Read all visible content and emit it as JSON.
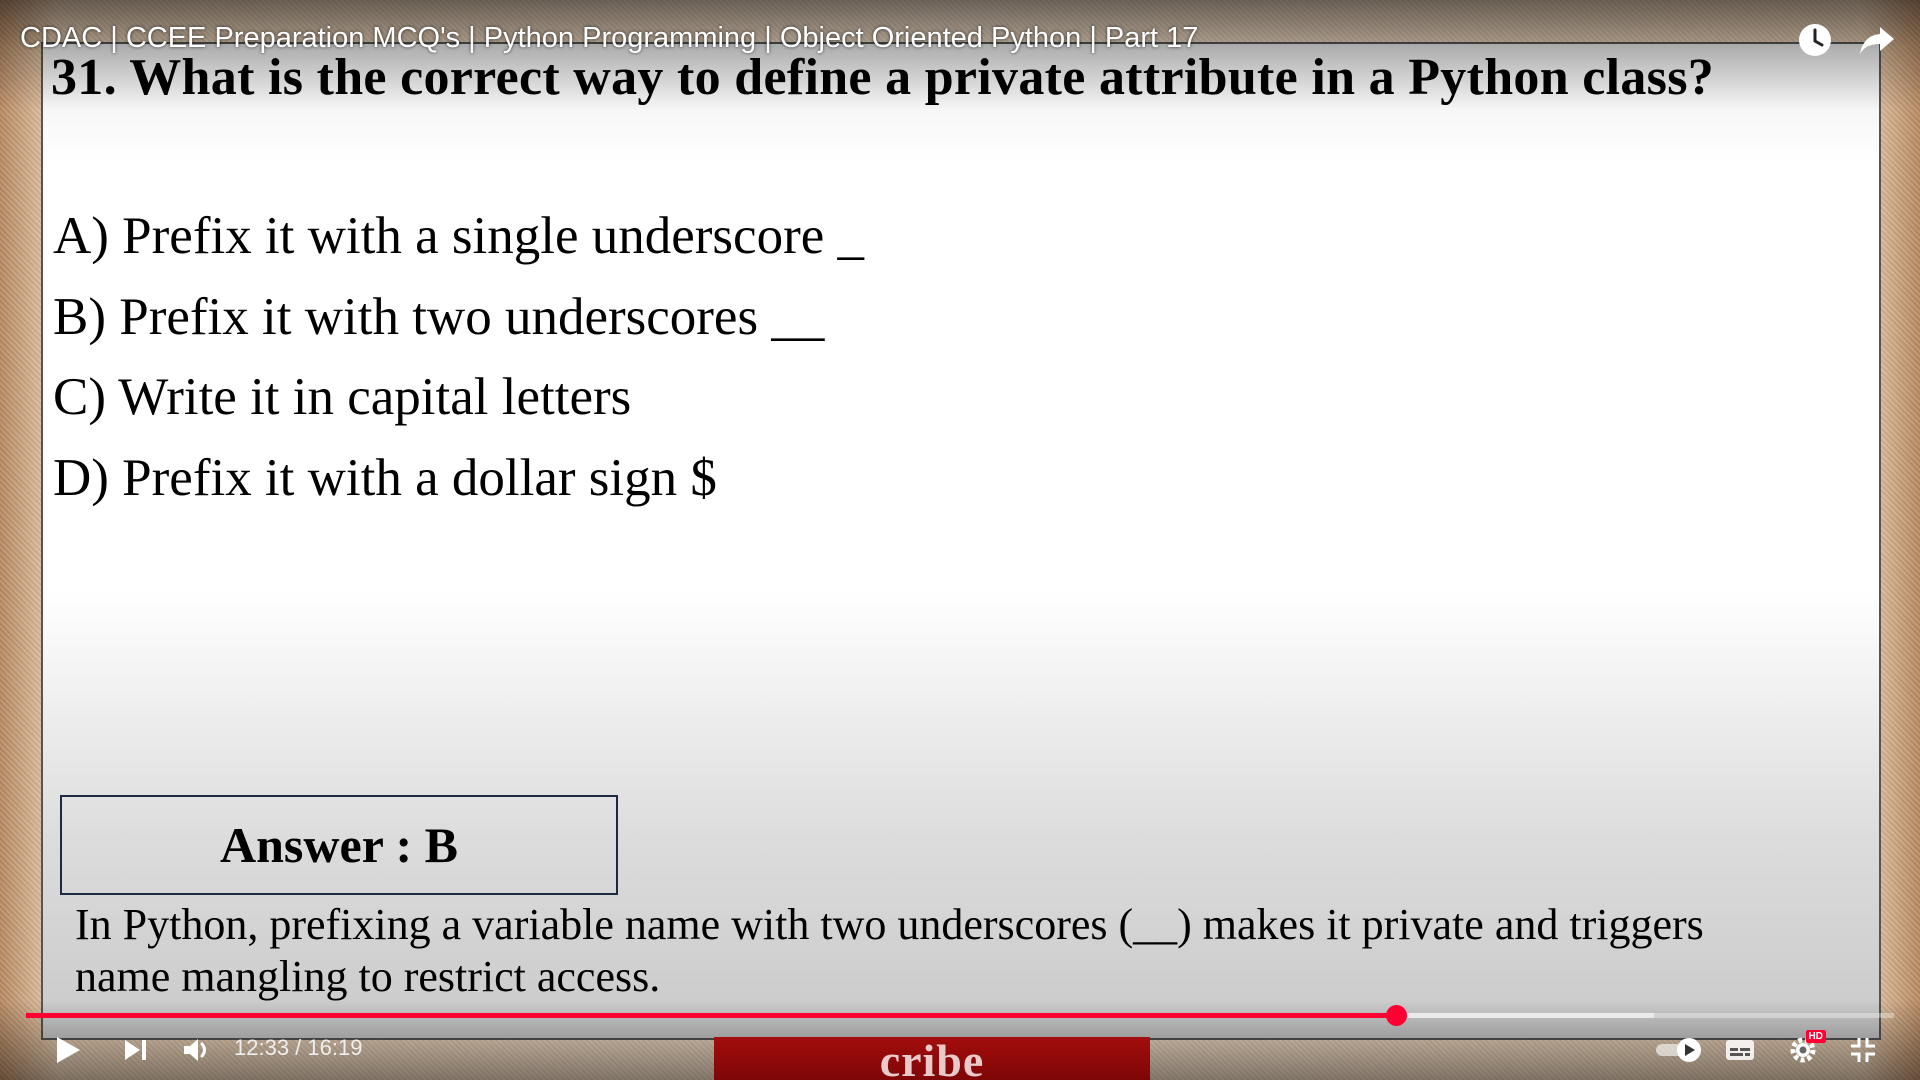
{
  "video": {
    "title": "CDAC | CCEE Preparation MCQ's | Python Programming | Object Oriented Python | Part 17",
    "time": "12:33 / 16:19",
    "progress_fraction": 0.7335,
    "buffered_fraction": 0.8715,
    "accent_color": "#ff0033",
    "top_icons": [
      "clock-icon",
      "share-arrow-icon"
    ],
    "controls": [
      "play-icon",
      "next-icon",
      "volume-icon",
      "autoplay-toggle-icon",
      "subtitles-icon",
      "settings-gear-icon",
      "exit-fullscreen-icon"
    ],
    "settings_badge": "HD",
    "banner_text": "cribe"
  },
  "slide": {
    "question": "31. What is the correct way to define a private attribute in a Python class?",
    "options": [
      "A) Prefix it with a single underscore _",
      "B) Prefix it with two underscores __",
      "C) Write it in capital letters",
      "D) Prefix it with a dollar sign $"
    ],
    "answer": "Answer : B",
    "explanation": "In Python, prefixing a variable name with two underscores (__) makes it private and triggers name mangling to restrict access."
  }
}
